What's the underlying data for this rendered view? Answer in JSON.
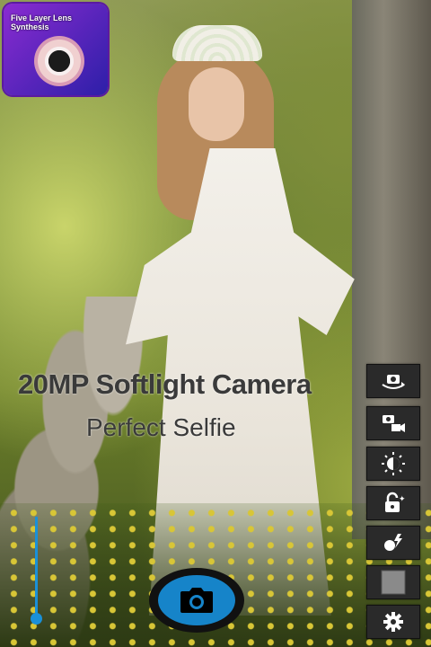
{
  "promo": {
    "badge_text": "Five Layer Lens Synthesis",
    "headline": "20MP Softlight Camera",
    "subline": "Perfect Selfie"
  },
  "toolbar": {
    "items": [
      {
        "name": "switch-camera",
        "icon": "rotate-camera-icon"
      },
      {
        "name": "photo-video-mode",
        "icon": "camera-video-icon"
      },
      {
        "name": "exposure",
        "icon": "sun-icon"
      },
      {
        "name": "timer-lock",
        "icon": "lock-timer-icon"
      },
      {
        "name": "flash",
        "icon": "flash-icon"
      },
      {
        "name": "filter",
        "icon": "square-filter-icon"
      },
      {
        "name": "settings",
        "icon": "gear-icon"
      }
    ]
  },
  "controls": {
    "shutter_icon": "camera-icon",
    "zoom_level": 0
  },
  "colors": {
    "accent": "#1684c9",
    "button_bg": "#2a2a2a",
    "badge_gradient_start": "#8a2bd1",
    "badge_gradient_end": "#2d1fa8"
  }
}
